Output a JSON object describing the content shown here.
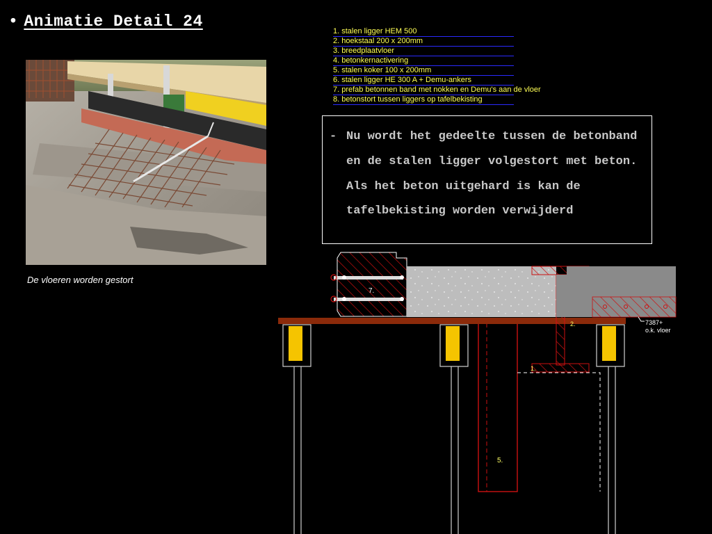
{
  "slide": {
    "bullet": "•",
    "title": "Animatie Detail 24",
    "caption": "De vloeren worden gestort"
  },
  "legend": [
    "1. stalen ligger HEM 500",
    "2. hoekstaal 200 x 200mm",
    "3. breedplaatvloer",
    "4. betonkernactivering",
    "5. stalen koker 100 x 200mm",
    "6. stalen ligger HE 300 A + Demu-ankers",
    "7. prefab betonnen band met nokken en Demu's aan de vloer",
    "8. betonstort tussen liggers op tafelbekisting"
  ],
  "note": {
    "dash": "-",
    "text": "Nu wordt het gedeelte tussen de betonband en de stalen ligger volgestort met beton. Als het beton uitgehard is kan de tafelbekisting worden verwijderd"
  },
  "drawing": {
    "label_7": "7.",
    "label_2": "2.",
    "label_1": "1.",
    "label_5": "5.",
    "level_value": "7387+",
    "level_text": "o.k. vloer"
  },
  "colors": {
    "background": "#000000",
    "legend_text": "#ffff55",
    "hatch_red": "#cc1111",
    "formwork_brown": "#8b2a0a",
    "prop_yellow": "#f5c400",
    "concrete": "#bdbdbd"
  }
}
